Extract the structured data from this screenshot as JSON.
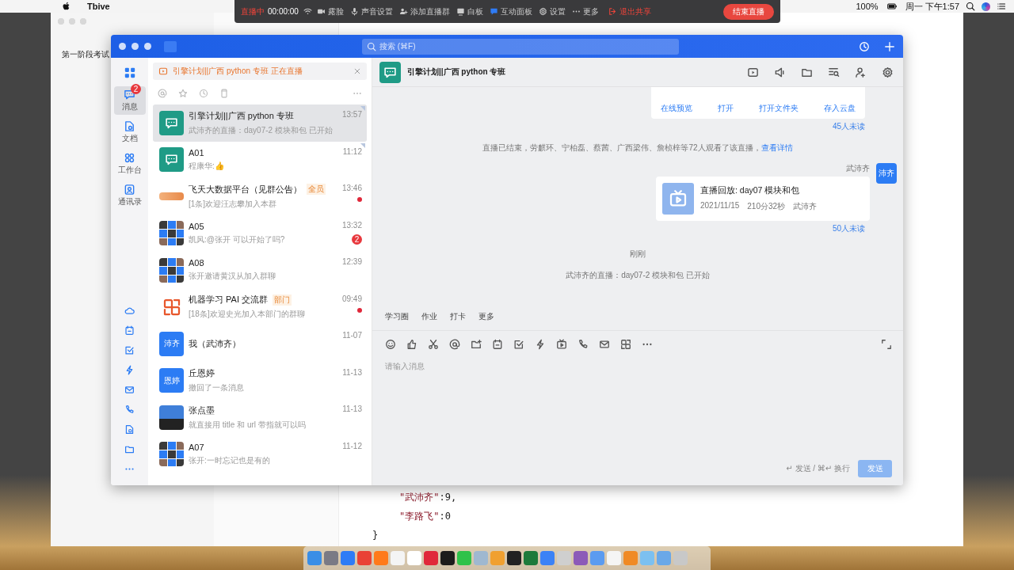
{
  "menubar": {
    "app": "Tbive",
    "battery": "100%",
    "clock": "周一 下午1:57"
  },
  "share_toolbar": {
    "status": "直播中",
    "timer": "00:00:00",
    "items": [
      {
        "label": "露脸"
      },
      {
        "label": "声音设置"
      },
      {
        "label": "添加直播群"
      },
      {
        "label": "白板"
      },
      {
        "label": "互动面板"
      },
      {
        "label": "设置"
      },
      {
        "label": "更多"
      }
    ],
    "stop_share": "退出共享",
    "end_button": "结束直播"
  },
  "background_window": {
    "sidebar_title": "第一阶段考试",
    "code_lines": [
      {
        "key": "\"武沛齐\"",
        "rest": ":9,"
      },
      {
        "key": "\"李路飞\"",
        "rest": ":0"
      },
      {
        "rest": "}"
      }
    ]
  },
  "main_window": {
    "search": {
      "placeholder": "搜索 (⌘F)"
    },
    "rail": [
      {
        "label": "消息",
        "selected": true,
        "badge": "2"
      },
      {
        "label": "文档",
        "selected": false
      },
      {
        "label": "工作台",
        "selected": false
      },
      {
        "label": "通讯录",
        "selected": false
      }
    ],
    "live_banner": "引擎计划||广西 python 专班 正在直播",
    "chats": [
      {
        "name": "引擎计划||广西 python 专班",
        "time": "13:57",
        "preview": "武沛齐的直播：day07-2 模块和包 已开始",
        "selected": true,
        "pinned": true,
        "unread_dot": false,
        "avatar": {
          "kind": "class"
        }
      },
      {
        "name": "A01",
        "time": "11:12",
        "preview": "程康华:👍",
        "selected": false,
        "pinned": true,
        "unread_dot": false,
        "avatar": {
          "kind": "class"
        }
      },
      {
        "name": "飞天大数据平台（见群公告）",
        "tag": "全员",
        "time": "13:46",
        "preview": "[1条]欢迎汪志攀加入本群",
        "selected": false,
        "pinned": false,
        "unread_dot": true,
        "avatar": {
          "kind": "logo"
        }
      },
      {
        "name": "A05",
        "time": "13:32",
        "preview": "凯风:@张开  可以开始了吗?",
        "badge": "2",
        "selected": false,
        "pinned": false,
        "unread_dot": false,
        "avatar": {
          "kind": "grid"
        }
      },
      {
        "name": "A08",
        "time": "12:39",
        "preview": "张开邀请黄汉从加入群聊",
        "selected": false,
        "pinned": false,
        "unread_dot": false,
        "avatar": {
          "kind": "grid"
        }
      },
      {
        "name": "机器学习 PAI 交流群",
        "tag": "部门",
        "time": "09:49",
        "preview": "[18条]欢迎史光加入本部门的群聊",
        "selected": false,
        "pinned": false,
        "unread_dot": true,
        "avatar": {
          "kind": "pai"
        }
      },
      {
        "name": "我（武沛齐）",
        "time": "11-07",
        "selected": false,
        "pinned": false,
        "unread_dot": false,
        "avatar": {
          "kind": "text",
          "text": "沛齐"
        }
      },
      {
        "name": "丘恩婷",
        "time": "11-13",
        "preview": "撤回了一条消息",
        "selected": false,
        "pinned": false,
        "unread_dot": false,
        "avatar": {
          "kind": "text",
          "text": "恩婷"
        }
      },
      {
        "name": "张点墨",
        "time": "11-13",
        "preview": "就直接用 title 和 url 带指就可以吗",
        "selected": false,
        "pinned": false,
        "unread_dot": false,
        "avatar": {
          "kind": "photo"
        }
      },
      {
        "name": "A07",
        "time": "11-12",
        "preview": "张开:一时忘记也是有的",
        "selected": false,
        "pinned": false,
        "unread_dot": false,
        "avatar": {
          "kind": "grid"
        }
      }
    ],
    "conversation": {
      "title": "引擎计划||广西 python 专班",
      "messages": [
        {
          "kind": "file_actions",
          "actions": [
            "在线预览",
            "打开",
            "打开文件夹",
            "存入云盘"
          ]
        },
        {
          "kind": "receipt",
          "text": "45人未读"
        },
        {
          "kind": "system",
          "text": "直播已结束，劳麒环、宁柏磊、蔡茜、广西梁伟、詹桢梓等72人观看了该直播，",
          "link": "查看详情"
        },
        {
          "kind": "live_card",
          "sender": "武沛齐",
          "avatar": "沛齐",
          "title": "直播回放: day07 模块和包",
          "date": "2021/11/15",
          "duration": "210分32秒",
          "host": "武沛齐"
        },
        {
          "kind": "receipt",
          "text": "50人未读"
        },
        {
          "kind": "time",
          "text": "刚刚"
        },
        {
          "kind": "system",
          "text": "武沛齐的直播：day07-2 模块和包 已开始"
        }
      ],
      "quick_tabs": [
        "学习圈",
        "作业",
        "打卡",
        "更多"
      ],
      "input": {
        "placeholder": "请输入消息"
      },
      "hint": "↵ 发送 / ⌘↵ 换行",
      "send_button": "发送"
    }
  }
}
